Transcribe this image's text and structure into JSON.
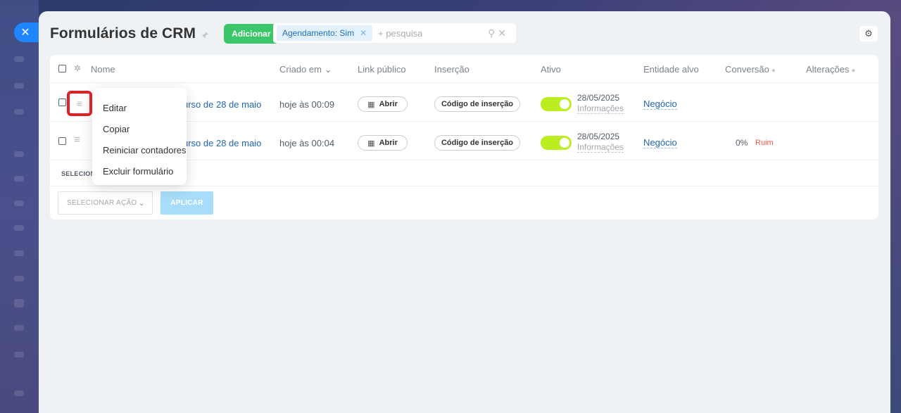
{
  "close_button": {
    "icon": "close-icon",
    "glyph": "✕"
  },
  "header": {
    "title": "Formulários de CRM",
    "add_label": "Adicionar"
  },
  "filter": {
    "chip_label": "Agendamento: Sim",
    "placeholder": "+ pesquisa"
  },
  "columns": {
    "name": "Nome",
    "created": "Criado em",
    "public_link": "Link público",
    "insertion": "Inserção",
    "active": "Ativo",
    "target_entity": "Entidade alvo",
    "conversion": "Conversão",
    "changes": "Alterações"
  },
  "rows": [
    {
      "name": "urso de 28 de maio",
      "created": "hoje às 00:09",
      "open_label": "Abrir",
      "insert_label": "Código de inserção",
      "active_date": "28/05/2025",
      "active_info": "Informações",
      "entity": "Negócio",
      "conversion": "",
      "conversion_status": ""
    },
    {
      "name": "urso de 28 de maio",
      "created": "hoje às 00:04",
      "open_label": "Abrir",
      "insert_label": "Código de inserção",
      "active_date": "28/05/2025",
      "active_info": "Informações",
      "entity": "Negócio",
      "conversion": "0%",
      "conversion_status": "Ruim"
    }
  ],
  "footer": {
    "selected_label": "SELECIONA",
    "action_placeholder": "SELECIONAR AÇÃO",
    "apply_label": "APLICAR"
  },
  "context_menu": {
    "items": [
      "Editar",
      "Copiar",
      "Reiniciar contadores",
      "Excluir formulário"
    ]
  },
  "colors": {
    "accent": "#3bc66a",
    "toggle_on": "#bbed21",
    "link": "#2067b0",
    "highlight": "#e21f26",
    "status_bad": "#f0584c"
  }
}
